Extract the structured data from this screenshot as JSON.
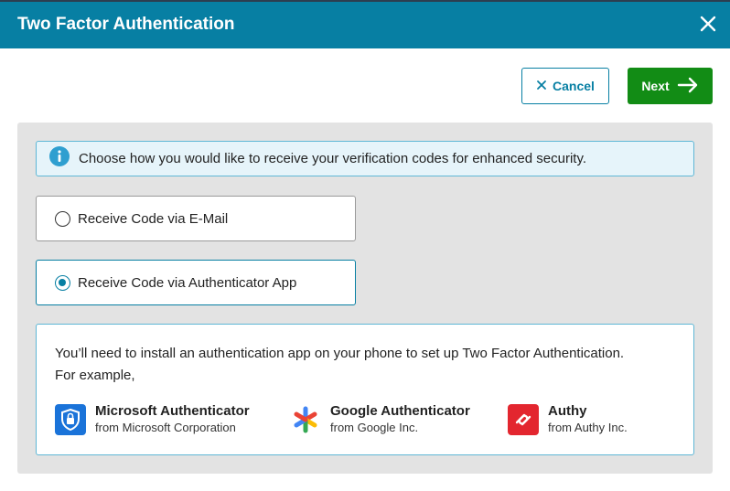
{
  "dialog": {
    "title": "Two Factor Authentication"
  },
  "actions": {
    "cancel_label": "Cancel",
    "next_label": "Next"
  },
  "info": {
    "text": "Choose how you would like to receive your verification codes for enhanced security."
  },
  "options": [
    {
      "label": "Receive Code via E-Mail",
      "selected": false
    },
    {
      "label": "Receive Code via Authenticator App",
      "selected": true
    }
  ],
  "apps_section": {
    "line1": "You’ll need to install an authentication app on your phone to set up Two Factor Authentication.",
    "line2": "For example,",
    "apps": [
      {
        "name": "Microsoft Authenticator",
        "vendor": "from Microsoft Corporation",
        "icon": "microsoft-authenticator-icon"
      },
      {
        "name": "Google Authenticator",
        "vendor": "from Google Inc.",
        "icon": "google-authenticator-icon"
      },
      {
        "name": "Authy",
        "vendor": "from Authy Inc.",
        "icon": "authy-icon"
      }
    ]
  },
  "colors": {
    "header": "#077fa3",
    "next_button": "#128c15",
    "info_border": "#5fb7d6",
    "panel": "#e3e3e3"
  }
}
